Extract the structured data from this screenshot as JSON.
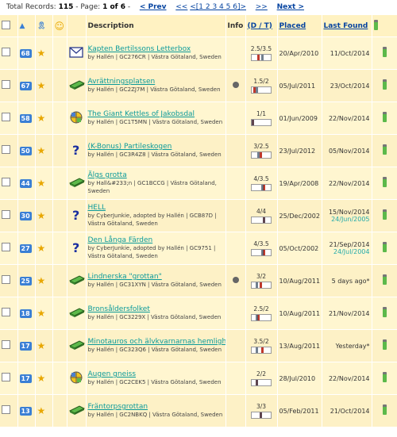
{
  "pager": {
    "total_label": "Total Records:",
    "total": "115",
    "page_label": "- Page:",
    "page_info": "1 of 6",
    "dash": "-",
    "prev": "< Prev",
    "first": "<<",
    "pages": "<[1 2 3 4 5 6]>",
    "last": ">>",
    "next": "Next >"
  },
  "headers": {
    "description": "Description",
    "info": "Info",
    "dt": "(D / T)",
    "placed": "Placed",
    "last_found": "Last Found",
    "sort_arrow": "▲",
    "ribbon": "🎗",
    "smiley": "☺"
  },
  "rows": [
    {
      "num": "68",
      "icon": "letterbox",
      "name": "Kapten Bertilssons Letterbox",
      "by": "by Hallén | GC276CR | Västra Götaland, Sweden",
      "info": false,
      "dt": "2.5/3.5",
      "placed": "20/Apr/2010",
      "found": "11/Oct/2014",
      "found2": ""
    },
    {
      "num": "67",
      "icon": "traditional",
      "name": "Avrättningsplatsen",
      "by": "by Hallén | GC2ZJ7M | Västra Götaland, Sweden",
      "info": true,
      "dt": "1.5/2",
      "placed": "05/Jul/2011",
      "found": "23/Oct/2014",
      "found2": ""
    },
    {
      "num": "58",
      "icon": "multi",
      "name": "The Giant Kettles of Jakobsdal",
      "by": "by Hallén | GC1T5MN | Västra Götaland, Sweden",
      "info": false,
      "dt": "1/1",
      "placed": "01/Jun/2009",
      "found": "22/Nov/2014",
      "found2": ""
    },
    {
      "num": "50",
      "icon": "mystery",
      "name": "(K-Bonus) Partileskogen",
      "by": "by Hallén | GC3R4Z8 | Västra Götaland, Sweden",
      "info": false,
      "dt": "3/2.5",
      "placed": "23/Jul/2012",
      "found": "05/Nov/2014",
      "found2": ""
    },
    {
      "num": "44",
      "icon": "traditional",
      "name": "Älgs grotta",
      "by": "by Hall&#233;n | GC1BCCG | Västra Götaland, Sweden",
      "info": false,
      "dt": "4/3.5",
      "placed": "19/Apr/2008",
      "found": "22/Nov/2014",
      "found2": ""
    },
    {
      "num": "30",
      "icon": "mystery",
      "name": "HELL",
      "by": "by CyberJunkie, adopted by Hallén | GCB87D | Västra Götaland, Sweden",
      "info": false,
      "dt": "4/4",
      "placed": "25/Dec/2002",
      "found": "15/Nov/2014",
      "found2": "24/Jun/2005"
    },
    {
      "num": "27",
      "icon": "mystery",
      "name": "Den Långa Färden",
      "by": "by CyberJunkie, adopted by Hallén | GC9751 | Västra Götaland, Sweden",
      "info": false,
      "dt": "4/3.5",
      "placed": "05/Oct/2002",
      "found": "21/Sep/2014",
      "found2": "24/Jul/2004"
    },
    {
      "num": "25",
      "icon": "traditional",
      "name": "Lindnerska \"grottan\"",
      "by": "by Hallén | GC31XYN | Västra Götaland, Sweden",
      "info": true,
      "dt": "3/2",
      "placed": "10/Aug/2011",
      "found": "5 days ago*",
      "found2": ""
    },
    {
      "num": "18",
      "icon": "traditional",
      "name": "Bronsåldersfolket",
      "by": "by Hallén | GC3229X | Västra Götaland, Sweden",
      "info": false,
      "dt": "2.5/2",
      "placed": "10/Aug/2011",
      "found": "21/Nov/2014",
      "found2": ""
    },
    {
      "num": "17",
      "icon": "traditional",
      "name": "Minotauros och älvkvarnarnas hemlighet",
      "by": "by Hallén | GC323Q6 | Västra Götaland, Sweden",
      "info": false,
      "dt": "3.5/2",
      "placed": "13/Aug/2011",
      "found": "Yesterday*",
      "found2": ""
    },
    {
      "num": "17",
      "icon": "multi",
      "name": "Augen gneiss",
      "by": "by Hallén | GC2CEK5 | Västra Götaland, Sweden",
      "info": false,
      "dt": "2/2",
      "placed": "28/Jul/2010",
      "found": "22/Nov/2014",
      "found2": ""
    },
    {
      "num": "13",
      "icon": "traditional",
      "name": "Fräntorpsgrottan",
      "by": "by Hallén | GC2NBKQ | Västra Götaland, Sweden",
      "info": false,
      "dt": "3/3",
      "placed": "05/Feb/2011",
      "found": "21/Oct/2014",
      "found2": ""
    }
  ]
}
